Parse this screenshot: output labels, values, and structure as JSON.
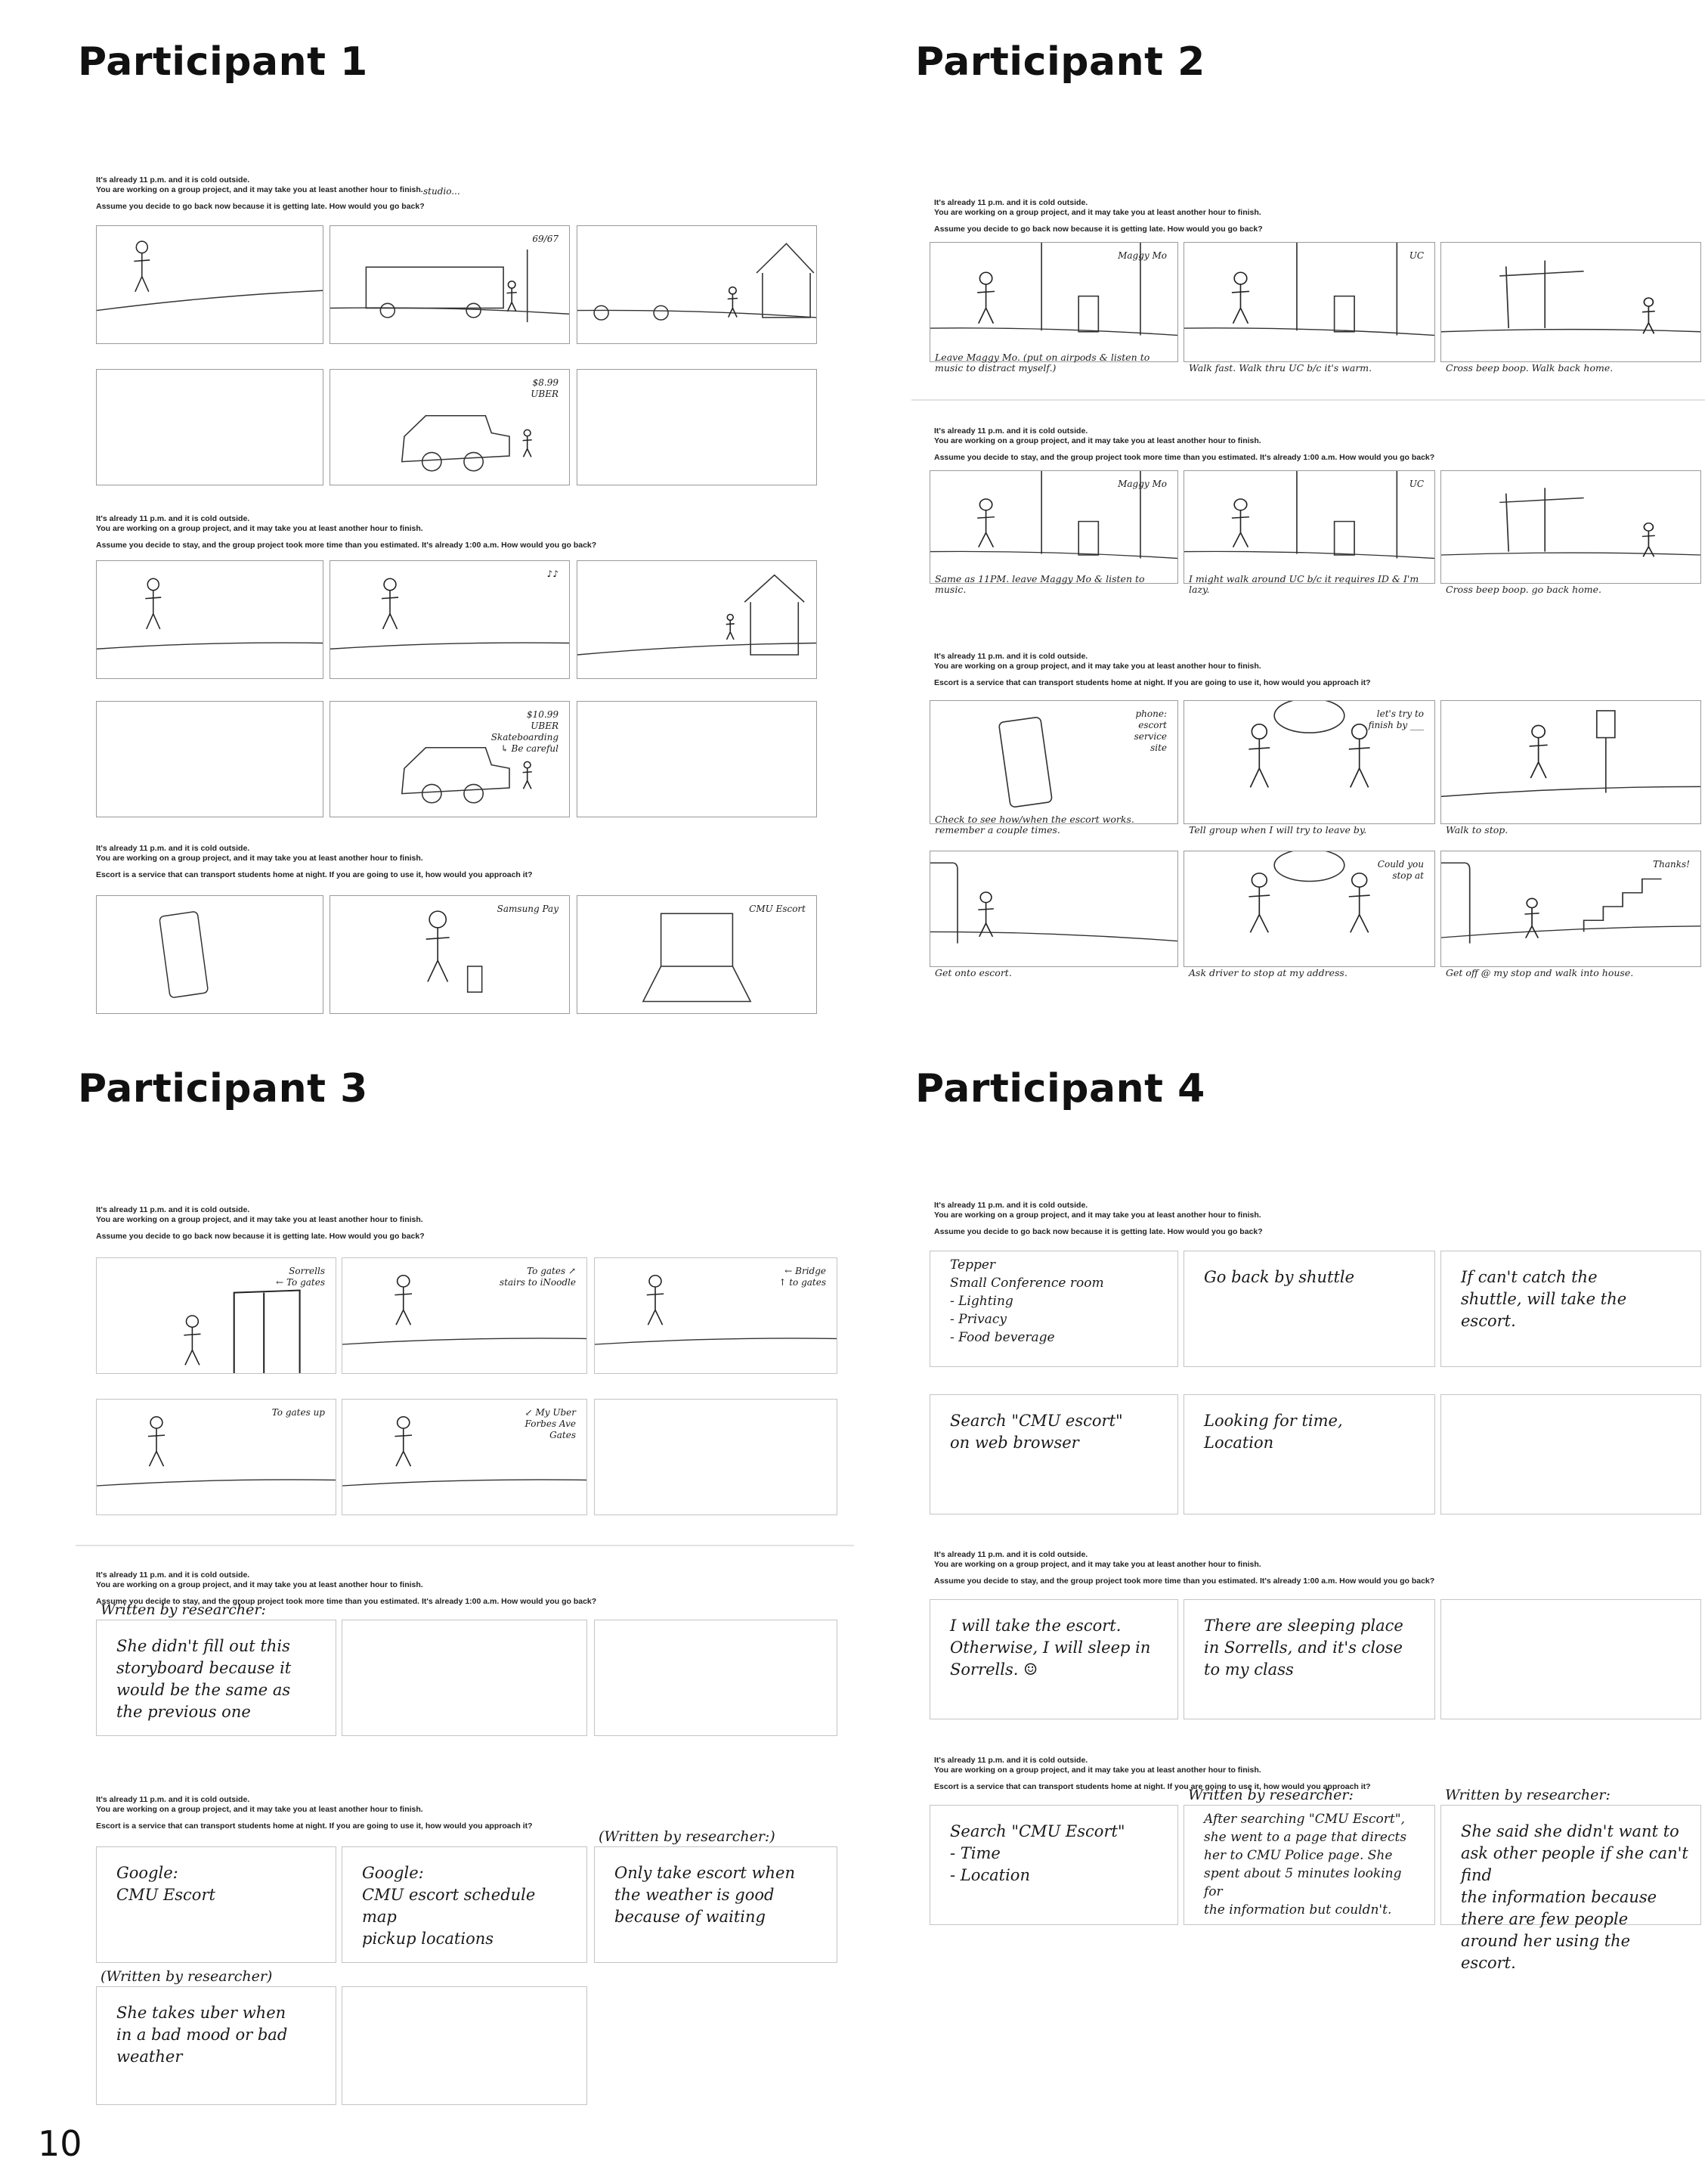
{
  "page_number": "10",
  "participants": [
    {
      "title": "Participant 1",
      "sections": [
        {
          "prompt": [
            "It's already 11 p.m. and it is cold outside.",
            "You are working on a group project, and it may take you at least another hour to finish.",
            "Assume you decide to go back now because it is getting late. How would you go back?"
          ],
          "note": "studio...",
          "panels": [
            {
              "labels": []
            },
            {
              "labels": [
                "69/67"
              ]
            },
            {
              "labels": []
            },
            {
              "labels": []
            },
            {
              "labels": [
                "$8.99",
                "UBER"
              ]
            },
            {
              "labels": []
            }
          ]
        },
        {
          "prompt": [
            "It's already 11 p.m. and it is cold outside.",
            "You are working on a group project, and it may take you at least another hour to finish.",
            "Assume you decide to stay, and the group project took more time than you estimated. It's already 1:00 a.m. How would you go back?"
          ],
          "panels": [
            {
              "labels": []
            },
            {
              "labels": [
                "♪♪"
              ]
            },
            {
              "labels": []
            },
            {
              "labels": []
            },
            {
              "labels": [
                "$10.99",
                "UBER",
                "Skateboarding",
                "↳ Be careful"
              ]
            },
            {
              "labels": []
            }
          ]
        },
        {
          "prompt": [
            "It's already 11 p.m. and it is cold outside.",
            "You are working on a group project, and it may take you at least another hour to finish.",
            "Escort is a service that can transport students home at night. If you are going to use it, how would you approach it?"
          ],
          "panels": [
            {
              "labels": []
            },
            {
              "labels": [
                "Samsung Pay"
              ]
            },
            {
              "labels": [
                "CMU Escort"
              ]
            }
          ]
        }
      ]
    },
    {
      "title": "Participant 2",
      "sections": [
        {
          "prompt": [
            "It's already 11 p.m. and it is cold outside.",
            "You are working on a group project, and it may take you at least another hour to finish.",
            "Assume you decide to go back now because it is getting late. How would you go back?"
          ],
          "panels": [
            {
              "labels": [
                "Maggy Mo"
              ],
              "caption": "Leave Maggy Mo. (put on airpods & listen to music to distract myself.)"
            },
            {
              "labels": [
                "UC"
              ],
              "caption": "Walk fast. Walk thru UC b/c it's warm."
            },
            {
              "labels": [],
              "caption": "Cross beep boop. Walk back home."
            }
          ]
        },
        {
          "prompt": [
            "It's already 11 p.m. and it is cold outside.",
            "You are working on a group project, and it may take you at least another hour to finish.",
            "Assume you decide to stay, and the group project took more time than you estimated. It's already 1:00 a.m. How would you go back?"
          ],
          "panels": [
            {
              "labels": [
                "Maggy Mo"
              ],
              "caption": "Same as 11PM. leave Maggy Mo & listen to music."
            },
            {
              "labels": [
                "UC"
              ],
              "caption": "I might walk around UC b/c it requires ID & I'm lazy."
            },
            {
              "labels": [],
              "caption": "Cross beep boop. go back home."
            }
          ]
        },
        {
          "prompt": [
            "It's already 11 p.m. and it is cold outside.",
            "You are working on a group project, and it may take you at least another hour to finish.",
            "Escort is a service that can transport students home at night. If you are going to use it, how would you approach it?"
          ],
          "panels": [
            {
              "labels": [
                "phone:",
                "escort",
                "service",
                "site"
              ],
              "caption": "Check to see how/when the escort works. remember a couple times."
            },
            {
              "labels": [
                "let's try to",
                "finish by ___"
              ],
              "caption": "Tell group when I will try to leave by."
            },
            {
              "labels": [],
              "caption": "Walk to stop."
            },
            {
              "labels": [],
              "caption": "Get onto escort."
            },
            {
              "labels": [
                "Could you",
                "stop at"
              ],
              "caption": "Ask driver to stop at my address."
            },
            {
              "labels": [
                "Thanks!"
              ],
              "caption": "Get off @ my stop and walk into house."
            }
          ]
        }
      ]
    },
    {
      "title": "Participant 3",
      "sections": [
        {
          "prompt": [
            "It's already 11 p.m. and it is cold outside.",
            "You are working on a group project, and it may take you at least another hour to finish.",
            "Assume you decide to go back now because it is getting late. How would you go back?"
          ],
          "panels": [
            {
              "labels": [
                "Sorrells",
                "← To gates"
              ]
            },
            {
              "labels": [
                "To gates ↗",
                "stairs to iNoodle"
              ]
            },
            {
              "labels": [
                "← Bridge",
                "↑ to gates"
              ]
            },
            {
              "labels": [
                "To gates up"
              ]
            },
            {
              "labels": [
                "↙ My Uber",
                "Forbes Ave",
                "Gates"
              ]
            },
            {
              "labels": []
            }
          ]
        },
        {
          "prompt": [
            "It's already 11 p.m. and it is cold outside.",
            "You are working on a group project, and it may take you at least another hour to finish.",
            "Assume you decide to stay, and the group project took more time than you estimated. It's already 1:00 a.m. How would you go back?"
          ],
          "above": [
            "Written by researcher:"
          ],
          "panels": [
            {
              "text": [
                "She didn't fill out this",
                "storyboard because it",
                "would be the same as",
                "the previous one"
              ]
            },
            {
              "text": []
            },
            {
              "text": []
            }
          ]
        },
        {
          "prompt": [
            "It's already 11 p.m. and it is cold outside.",
            "You are working on a group project, and it may take you at least another hour to finish.",
            "Escort is a service that can transport students home at night. If you are going to use it, how would you approach it?"
          ],
          "above": [
            "",
            "",
            "(Written by researcher:)",
            "(Written by researcher)"
          ],
          "panels": [
            {
              "text": [
                "Google:",
                "CMU Escort"
              ]
            },
            {
              "text": [
                "Google:",
                "CMU escort schedule",
                "map",
                "pickup locations"
              ]
            },
            {
              "text": [
                "Only take escort when",
                "the weather is good",
                "because of waiting"
              ]
            },
            {
              "text": [
                "She takes uber when",
                "in a bad mood or bad",
                "weather"
              ]
            },
            {
              "text": []
            }
          ]
        }
      ]
    },
    {
      "title": "Participant 4",
      "sections": [
        {
          "prompt": [
            "It's already 11 p.m. and it is cold outside.",
            "You are working on a group project, and it may take you at least another hour to finish.",
            "Assume you decide to go back now because it is getting late. How would you go back?"
          ],
          "panels": [
            {
              "text": [
                "Tepper",
                "Small Conference room",
                "- Lighting",
                "- Privacy",
                "- Food beverage"
              ]
            },
            {
              "text": [
                "Go back by shuttle"
              ]
            },
            {
              "text": [
                "If can't catch the",
                "shuttle, will take the",
                "escort."
              ]
            },
            {
              "text": [
                "Search \"CMU escort\"",
                "on web browser"
              ]
            },
            {
              "text": [
                "Looking for time,",
                "Location"
              ]
            },
            {
              "text": []
            }
          ]
        },
        {
          "prompt": [
            "It's already 11 p.m. and it is cold outside.",
            "You are working on a group project, and it may take you at least another hour to finish.",
            "Assume you decide to stay, and the group project took more time than you estimated. It's already 1:00 a.m. How would you go back?"
          ],
          "panels": [
            {
              "text": [
                "I will take the escort.",
                "Otherwise, I will sleep in",
                "Sorrells. ☺"
              ]
            },
            {
              "text": [
                "There are sleeping place",
                "in Sorrells, and it's close",
                "to my class"
              ]
            },
            {
              "text": []
            }
          ]
        },
        {
          "prompt": [
            "It's already 11 p.m. and it is cold outside.",
            "You are working on a group project, and it may take you at least another hour to finish.",
            "Escort is a service that can transport students home at night. If you are going to use it, how would you approach it?"
          ],
          "above": [
            "",
            "Written by researcher:",
            "Written by researcher:"
          ],
          "panels": [
            {
              "text": [
                "Search \"CMU Escort\"",
                "- Time",
                "- Location"
              ]
            },
            {
              "text": [
                "After searching \"CMU Escort\",",
                "she went to a page that directs",
                "her to CMU Police page. She",
                "spent about 5 minutes looking for",
                "the information but couldn't."
              ]
            },
            {
              "text": [
                "She said she didn't want to",
                "ask other people if she can't find",
                "the information because there are few people",
                "around her using the escort."
              ]
            }
          ]
        }
      ]
    }
  ]
}
